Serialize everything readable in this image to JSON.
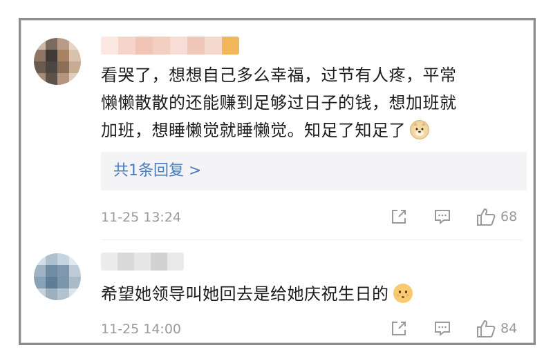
{
  "comments": [
    {
      "text_lines": [
        "看哭了，想想自己多么幸福，过节有人疼，平常",
        "懒懒散散的还能赚到足够过日子的钱，想加班就",
        "加班，想睡懒觉就睡懒觉。知足了知足了"
      ],
      "emoji": "doge-emoji",
      "replies_label": "共1条回复 >",
      "time": "11-25 13:24",
      "likes": "68"
    },
    {
      "text_lines": [
        "希望她领导叫她回去是给她庆祝生日的"
      ],
      "emoji": "sad-face-emoji",
      "time": "11-25 14:00",
      "likes": "84"
    }
  ],
  "colors": {
    "reply_link": "#4a7dbd",
    "meta_gray": "#9a9a9a",
    "reply_bg": "#f4f4f6"
  }
}
